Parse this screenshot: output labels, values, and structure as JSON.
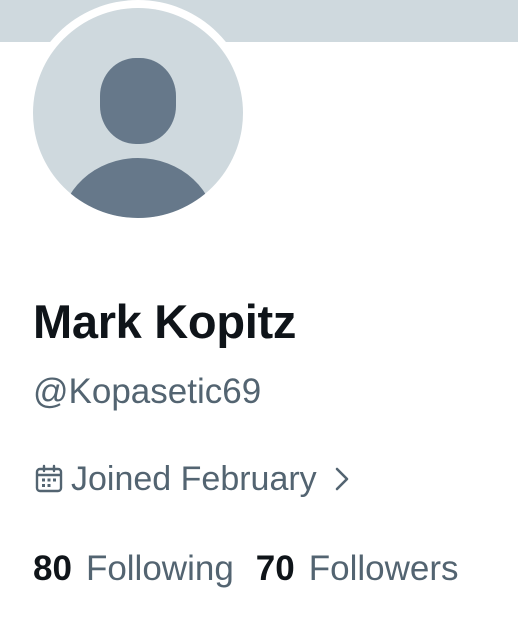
{
  "profile": {
    "display_name": "Mark Kopitz",
    "handle": "@Kopasetic69",
    "joined": "Joined February",
    "avatar_icon": "default-avatar-icon"
  },
  "stats": {
    "following_count": "80",
    "following_label": "Following",
    "followers_count": "70",
    "followers_label": "Followers"
  },
  "icons": {
    "calendar": "calendar-icon",
    "chevron": "chevron-right-icon"
  },
  "colors": {
    "banner": "#cfd9de",
    "avatar_bg": "#cfd9de",
    "avatar_figure": "#66788a",
    "text_primary": "#0f1419",
    "text_secondary": "#536471"
  }
}
